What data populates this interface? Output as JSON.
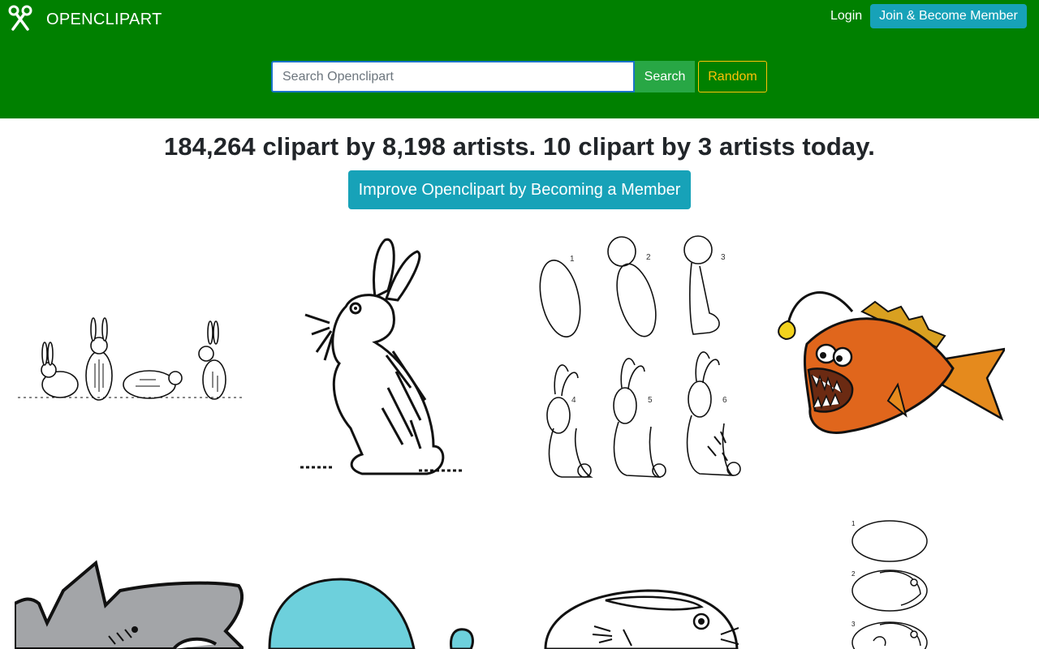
{
  "brand": {
    "name": "OPENCLIPART",
    "icon": "scissors-icon"
  },
  "nav": {
    "login": "Login",
    "join": "Join & Become Member"
  },
  "search": {
    "placeholder": "Search Openclipart",
    "value": "",
    "button": "Search",
    "random": "Random"
  },
  "stats": {
    "text": "184,264 clipart by 8,198 artists. 10 clipart by 3 artists today."
  },
  "cta": {
    "improve": "Improve Openclipart by Becoming a Member"
  },
  "colors": {
    "header": "#008000",
    "info": "#17a2b8",
    "success": "#28a745",
    "warning": "#ffc107",
    "anglerfish": "#e0661c",
    "whale": "#6dd0dc",
    "shark": "#a3a5a8"
  },
  "gallery": [
    {
      "name": "rabbit-group-clipart"
    },
    {
      "name": "standing-rabbit-clipart"
    },
    {
      "name": "how-to-draw-rabbit-clipart",
      "step_labels": [
        "1",
        "2",
        "3",
        "4",
        "5",
        "6"
      ]
    },
    {
      "name": "anglerfish-clipart"
    },
    {
      "name": "shark-clipart"
    },
    {
      "name": "whale-clipart"
    },
    {
      "name": "sleeping-rabbit-clipart"
    },
    {
      "name": "drawing-steps-clipart",
      "step_labels": [
        "1",
        "2",
        "3"
      ]
    }
  ]
}
